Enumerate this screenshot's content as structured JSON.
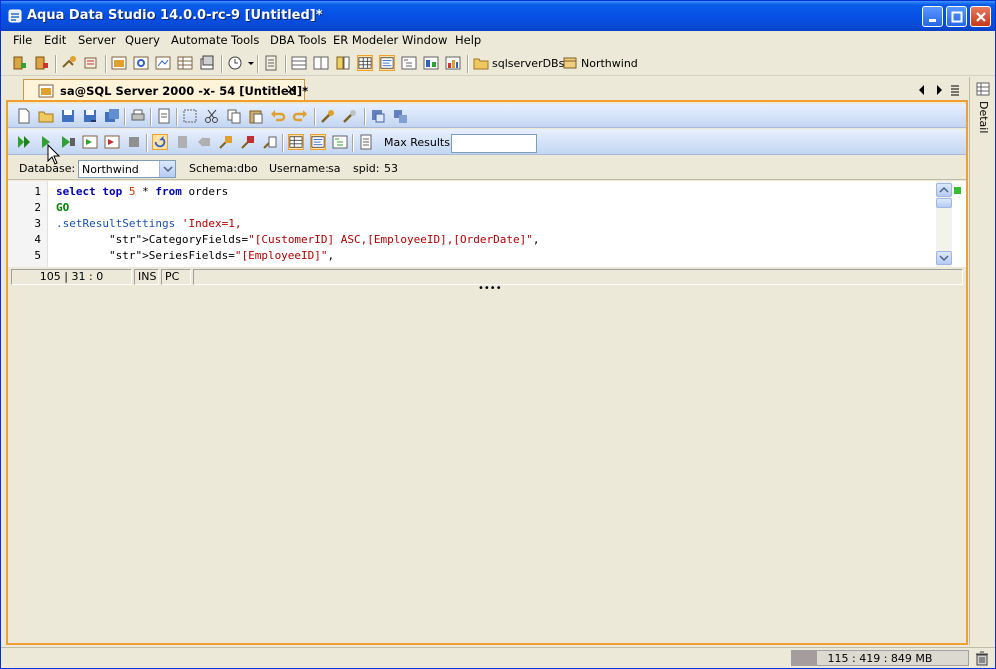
{
  "window": {
    "title": "Aqua Data Studio 14.0.0-rc-9 [Untitled]*"
  },
  "menu": [
    "File",
    "Edit",
    "Server",
    "Query",
    "Automate",
    "Tools",
    "DBA Tools",
    "ER Modeler",
    "Window",
    "Help"
  ],
  "main_toolbar": {
    "server_group": "sqlserverDBs",
    "database": "Northwind"
  },
  "doc_tab": {
    "label": "sa@SQL Server 2000 -x- 54 [Untitled]*",
    "close": "✕"
  },
  "query_toolbar": {
    "max_results_label": "Max Results:",
    "max_results_value": ""
  },
  "db_bar": {
    "database_label": "Database:",
    "database_value": "Northwind",
    "schema_label": "Schema:",
    "schema_value": "dbo",
    "username_label": "Username:",
    "username_value": "sa",
    "spid_label": "spid:",
    "spid_value": "53"
  },
  "editor": {
    "line_numbers": [
      "1",
      "2",
      "3",
      "4",
      "5"
    ],
    "lines": [
      "select top 5 * from orders",
      "GO",
      ".setResultSettings 'Index=1,",
      "        CategoryFields=\"[CustomerID] ASC,[EmployeeID],[OrderDate]\",",
      "        SeriesFields=\"[EmployeeID]\","
    ]
  },
  "status": {
    "position": "105 | 31 : 0",
    "mode": "INS",
    "line_ending": "PC",
    "extra": ""
  },
  "side_panel": {
    "label": "Detail"
  },
  "memory": {
    "text": "115 : 419 : 849 MB",
    "used_fraction": 0.14
  }
}
